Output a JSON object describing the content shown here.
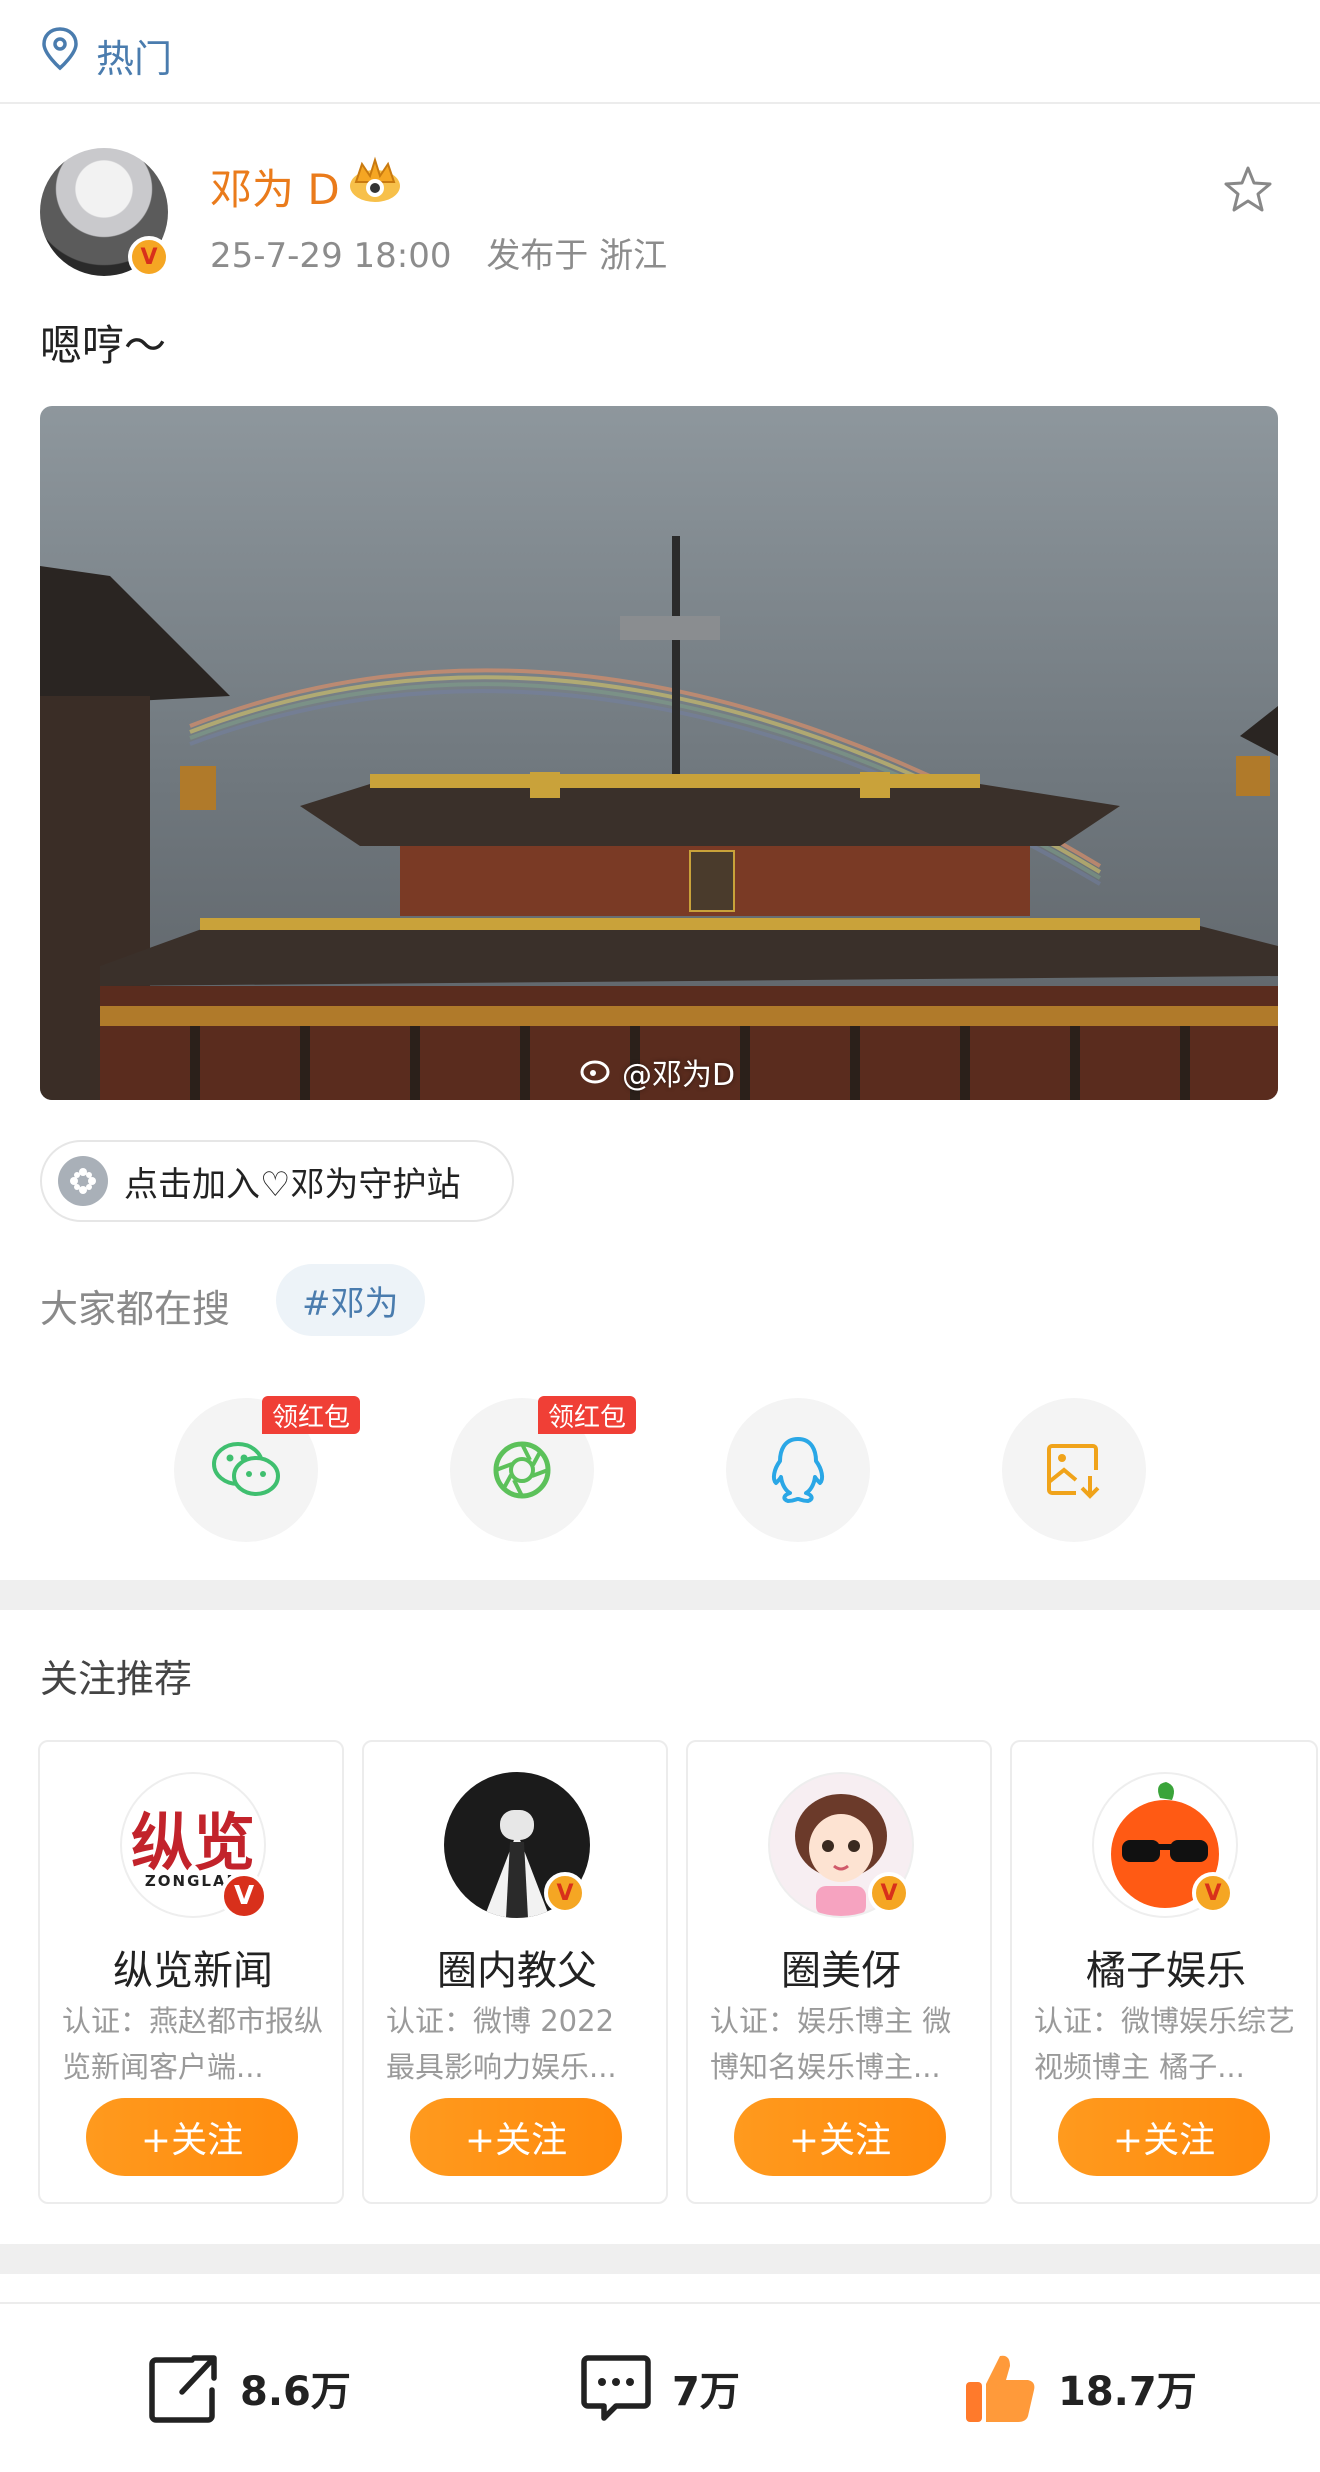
{
  "topbar": {
    "icon": "location-pin-icon",
    "label": "热门"
  },
  "post": {
    "author": {
      "name": "邓为 D",
      "verified": true,
      "badge_icon": "crown-icon"
    },
    "timestamp": "25-7-29 18:00",
    "location": "发布于 浙江",
    "text": "嗯哼～",
    "image_watermark": "@邓为D"
  },
  "join": {
    "label": "点击加入♡邓为守护站",
    "icon": "supertopic-icon"
  },
  "search": {
    "label": "大家都在搜",
    "tag": "#邓为"
  },
  "share": [
    {
      "name": "wechat",
      "icon": "wechat-icon",
      "badge": "领红包",
      "color": "#3fbf6f"
    },
    {
      "name": "moments",
      "icon": "moments-icon",
      "badge": "领红包",
      "color": "#5cc15a"
    },
    {
      "name": "qq",
      "icon": "qq-icon",
      "badge": "",
      "color": "#2aa7e6"
    },
    {
      "name": "save-image",
      "icon": "save-image-icon",
      "badge": "",
      "color": "#f0a31a"
    }
  ],
  "recommend": {
    "title": "关注推荐",
    "follow_label": "+关注",
    "cards": [
      {
        "name": "纵览新闻",
        "desc": "认证：燕赵都市报纵览新闻客户端...",
        "logo_text": "纵览",
        "logo_sub": "ZONGLAN"
      },
      {
        "name": "圈内教父",
        "desc": "认证：微博 2022 最具影响力娱乐..."
      },
      {
        "name": "圈美伢",
        "desc": "认证：娱乐博主 微博知名娱乐博主..."
      },
      {
        "name": "橘子娱乐",
        "desc": "认证：微博娱乐综艺视频博主 橘子..."
      }
    ]
  },
  "stats": {
    "reposts": "8.6万",
    "comments": "7万",
    "likes": "18.7万"
  },
  "colors": {
    "accent": "#ff8a0c",
    "link": "#4a7cae",
    "username": "#ea7b1b",
    "redpacket": "#f03f36"
  }
}
